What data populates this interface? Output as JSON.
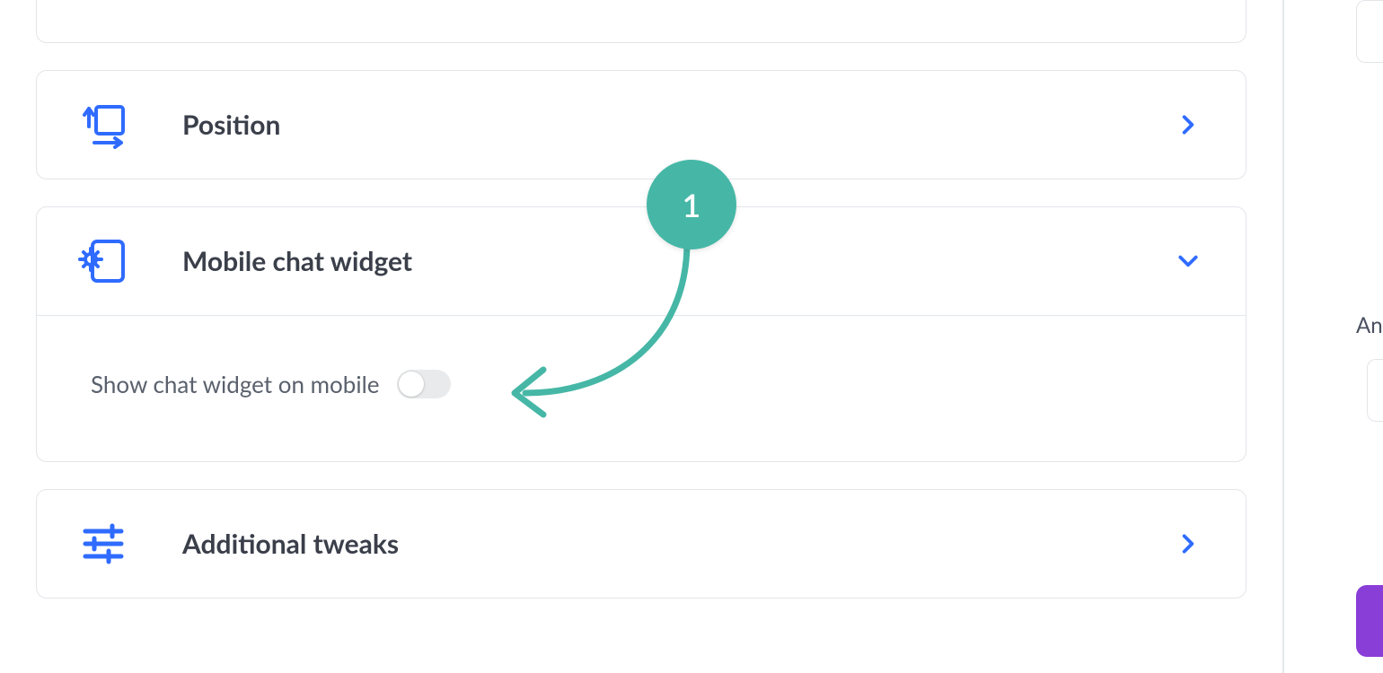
{
  "cards": {
    "position": {
      "title": "Position"
    },
    "mobile": {
      "title": "Mobile chat widget"
    },
    "tweaks": {
      "title": "Additional tweaks"
    }
  },
  "mobile_panel": {
    "show_on_mobile_label": "Show chat widget on mobile",
    "show_on_mobile_value": false
  },
  "annotation": {
    "badge_text": "1"
  },
  "side": {
    "label": "An"
  },
  "colors": {
    "accent": "#2f6bff",
    "annotation": "#46b7a6"
  }
}
